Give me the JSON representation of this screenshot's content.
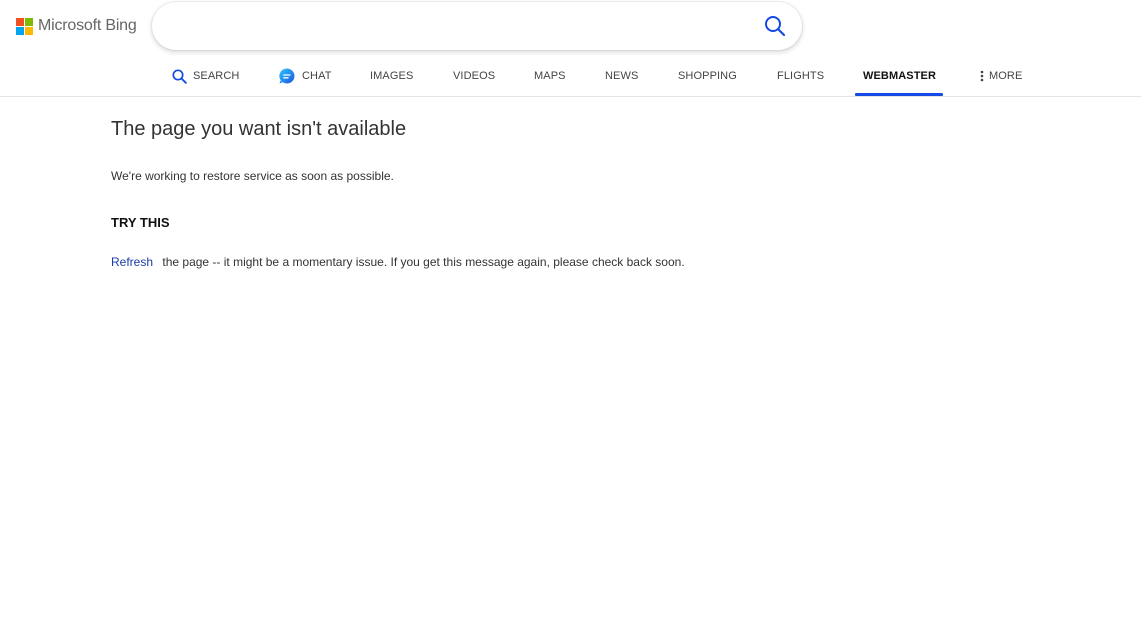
{
  "brand": {
    "logo_text": "Microsoft Bing",
    "logo_colors": [
      "#f25022",
      "#7fba00",
      "#00a4ef",
      "#ffb900"
    ]
  },
  "search": {
    "value": "",
    "placeholder": "",
    "icon": "search-icon"
  },
  "nav": {
    "items": [
      {
        "label": "SEARCH",
        "icon": "search-icon"
      },
      {
        "label": "CHAT",
        "icon": "chat-icon"
      },
      {
        "label": "IMAGES"
      },
      {
        "label": "VIDEOS"
      },
      {
        "label": "MAPS"
      },
      {
        "label": "NEWS"
      },
      {
        "label": "SHOPPING"
      },
      {
        "label": "FLIGHTS"
      },
      {
        "label": "WEBMASTER",
        "active": true
      },
      {
        "label": "MORE",
        "icon": "vertical-ellipsis-icon"
      }
    ],
    "accent_color": "#174ae4"
  },
  "content": {
    "title": "The page you want isn't available",
    "subtitle": "We're working to restore service as soon as possible.",
    "try_heading": "TRY THIS",
    "refresh_link": "Refresh",
    "refresh_text": "the page -- it might be a momentary issue. If you get this message again, please check back soon."
  }
}
